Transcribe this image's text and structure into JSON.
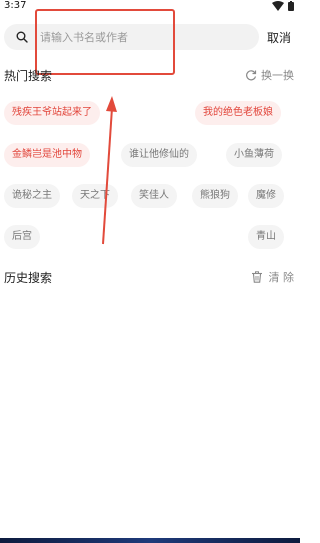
{
  "status": {
    "time": "3:37"
  },
  "search": {
    "placeholder": "请输入书名或作者",
    "value": "",
    "cancel_label": "取消"
  },
  "hot": {
    "title": "热门搜索",
    "refresh_label": "换一换",
    "tags": [
      {
        "label": "残疾王爷站起来了",
        "style": "hot"
      },
      {
        "label": "我的绝色老板娘",
        "style": "hot"
      },
      {
        "label": "金鳞岂是池中物",
        "style": "hot"
      },
      {
        "label": "谁让他修仙的",
        "style": "norm"
      },
      {
        "label": "小鱼薄荷",
        "style": "norm"
      },
      {
        "label": "诡秘之主",
        "style": "norm"
      },
      {
        "label": "天之下",
        "style": "norm"
      },
      {
        "label": "笑佳人",
        "style": "norm"
      },
      {
        "label": "熊狼狗",
        "style": "norm"
      },
      {
        "label": "魔修",
        "style": "norm"
      },
      {
        "label": "后宫",
        "style": "norm"
      },
      {
        "label": "青山",
        "style": "norm"
      }
    ]
  },
  "history": {
    "title": "历史搜索",
    "clear_label": "清 除"
  },
  "colors": {
    "accent": "#e2463c",
    "annotation": "#e24a3b",
    "tag_hot_bg": "#fdeeed",
    "tag_norm_bg": "#f4f4f4"
  },
  "icons": [
    "wifi-icon",
    "battery-icon",
    "search-icon",
    "refresh-icon",
    "trash-icon"
  ]
}
